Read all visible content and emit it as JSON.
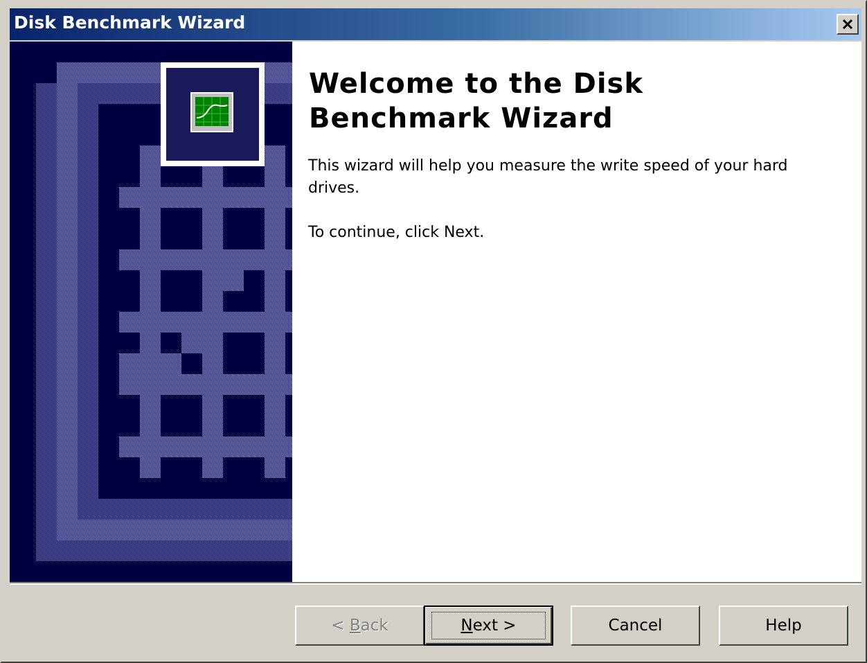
{
  "window": {
    "title": "Disk Benchmark Wizard",
    "close_label": "×"
  },
  "welcome": {
    "heading_line1": "Welcome to the Disk",
    "heading_line2": "Benchmark Wizard",
    "description": "This wizard will help you measure the write speed of your hard drives.",
    "continue_text": "To continue, click Next."
  },
  "buttons": {
    "back": {
      "prefix": "< ",
      "accel": "B",
      "rest": "ack",
      "enabled": false
    },
    "next": {
      "accel": "N",
      "rest": "ext >",
      "default": true
    },
    "cancel": {
      "label": "Cancel"
    },
    "help": {
      "label": "Help"
    }
  },
  "icons": {
    "close": "close-icon",
    "wizard_graphic": "disk-benchmark-wizard-icon"
  },
  "colors": {
    "titlebar_start": "#0a246a",
    "titlebar_end": "#a6caf0",
    "banner_background": "#000040",
    "banner_pattern": "#8080d0",
    "dialog_face": "#d4d0c8",
    "monitor_screen": "#008000"
  }
}
